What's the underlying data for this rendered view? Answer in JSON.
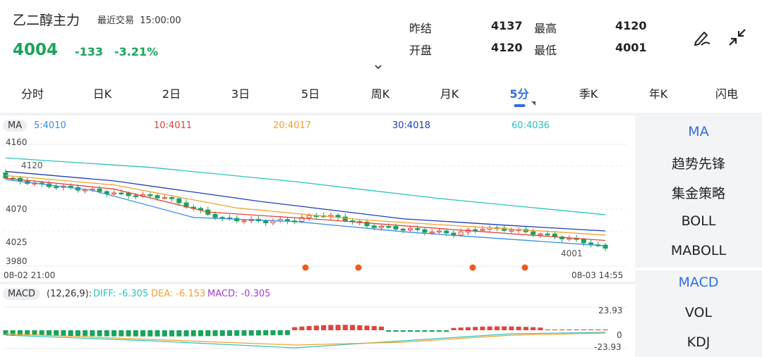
{
  "header": {
    "name": "乙二醇主力",
    "status": "最近交易",
    "time": "15:00:00",
    "price": "4004",
    "change": "-133",
    "change_pct": "-3.21%"
  },
  "quote": {
    "prev_settle_label": "昨结",
    "prev_settle": "4137",
    "high_label": "最高",
    "high": "4120",
    "open_label": "开盘",
    "open": "4120",
    "low_label": "最低",
    "low": "4001"
  },
  "tabs": [
    "分时",
    "日K",
    "2日",
    "3日",
    "5日",
    "周K",
    "月K",
    "5分",
    "季K",
    "年K",
    "闪电"
  ],
  "active_tab": "5分",
  "ma_bar": {
    "badge": "MA",
    "ma5": "5:4010",
    "ma10": "10:4011",
    "ma20": "20:4017",
    "ma30": "30:4018",
    "ma60": "60:4036",
    "colors": {
      "ma5": "#3a8ee6",
      "ma10": "#e0443c",
      "ma20": "#f0a030",
      "ma30": "#1b3fb5",
      "ma60": "#2cc4b8"
    }
  },
  "main_chart": {
    "y_ticks": [
      "4160",
      "4070",
      "4025",
      "3980"
    ],
    "high_label": "4120",
    "low_label": "4001",
    "start_time": "08-02 21:00",
    "end_time": "08-03 14:55"
  },
  "macd_bar": {
    "badge": "MACD",
    "params": "(12,26,9):",
    "diff": "DIFF: -6.305",
    "dea": "DEA: -6.153",
    "macd": "MACD: -0.305"
  },
  "macd_chart": {
    "y_top": "23.93",
    "y_zero": "0",
    "y_bottom": "-23.93"
  },
  "sidebar": {
    "group1": [
      "MA",
      "趋势先锋",
      "集金策略",
      "BOLL",
      "MABOLL"
    ],
    "group2": [
      "MACD",
      "VOL",
      "KDJ"
    ]
  },
  "colors": {
    "up": "#e0443c",
    "down": "#1aa35a",
    "accent": "#2f6de1"
  },
  "icons": [
    "pen-icon",
    "collapse-icon",
    "chevron-down-icon"
  ]
}
